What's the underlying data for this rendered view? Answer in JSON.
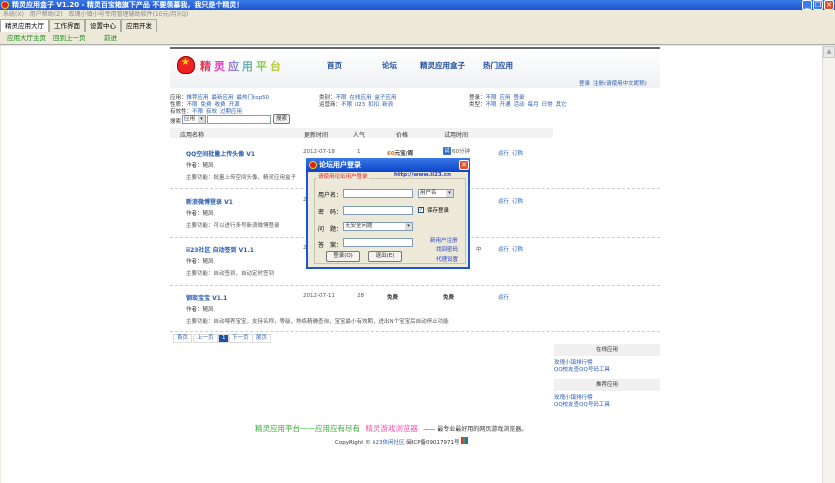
{
  "window": {
    "title": "精灵应用盒子 V1.20 - 精灵百宝箱旗下产品 不要羡慕我，我只是个精灵！",
    "minimize": "_",
    "restore": "❐",
    "close": "✕"
  },
  "menu": [
    "系统(X)",
    "用户帮助(Z)",
    "玫瑰小镇小号专用管理辅助软件(10元/月)(Q)"
  ],
  "tabs": [
    "精灵应用大厅",
    "工作界面",
    "设置中心",
    "应用开发"
  ],
  "toolbar": [
    "应用大厅主页",
    "回到上一页",
    "前进"
  ],
  "header": {
    "logo_text": "精灵应用平台",
    "nav": [
      "首页",
      "论坛",
      "精灵应用盒子",
      "热门应用"
    ],
    "login": "登录",
    "register": "注册(请使用中文昵称)"
  },
  "filters": {
    "app": {
      "label": "应用：",
      "items": [
        "推荐应用",
        "最新应用",
        "最热门top50"
      ]
    },
    "nature": {
      "label": "性质：",
      "items": [
        "不限",
        "免费",
        "收费",
        "开源"
      ]
    },
    "validity": {
      "label": "有效性：",
      "items": [
        "不限",
        "有效",
        "过期应用"
      ]
    },
    "category": {
      "label": "类别：",
      "items": [
        "不限",
        "在线应用",
        "盒子应用"
      ]
    },
    "operator": {
      "label": "运营商：",
      "items": [
        "不限",
        "ii23",
        "扣扣",
        "新浪"
      ]
    },
    "login": {
      "label": "登录：",
      "items": [
        "不限",
        "应用",
        "登录"
      ]
    },
    "type": {
      "label": "类型：",
      "items": [
        "不限",
        "开通",
        "活动",
        "每月",
        "日常",
        "其它"
      ]
    }
  },
  "search": {
    "label": "搜索",
    "select": "应用",
    "value": "",
    "button": "搜索"
  },
  "table": {
    "headers": [
      "应用名称",
      "更新时间",
      "人气",
      "价格",
      "试用时间"
    ],
    "author_label": "作者：",
    "func_label": "主要功能：",
    "rows": [
      {
        "name": "QQ空间批量上传头像 V1",
        "date": "2012-07-18",
        "pop": "1",
        "price_num": "60",
        "price_unit": "元宝/周",
        "trial": "60分钟",
        "author": "随风",
        "desc": "批量上传空间头像，精灵应用盒子",
        "actions": [
          "运行",
          "订购"
        ]
      },
      {
        "name": "新浪微博登录 V1",
        "date": "20",
        "pop": "",
        "price_num": "",
        "price_unit": "",
        "trial": "",
        "author": "随风",
        "desc": "可以进行多号新浪微博登录",
        "actions": [
          "运行",
          "订购"
        ]
      },
      {
        "name": "ii23社区 自动签到 V1.1",
        "date": "20",
        "pop": "",
        "price_num": "",
        "price_unit": "",
        "trial": "中",
        "author": "随风",
        "desc": "自动签到，自动定时签到",
        "actions": [
          "运行",
          "订购"
        ]
      },
      {
        "name": "钢琰宝宝 V1.1",
        "date": "2012-07-11",
        "pop": "28",
        "price_num": "",
        "price_unit": "免费",
        "trial": "免费",
        "author": "随风",
        "desc": "自动喂养宝宝，支持名称，等级，熟练精确查询，宝宝最小有效期，进出N个宝宝后自动停止功能",
        "actions": [
          "运行"
        ]
      }
    ]
  },
  "pagination": [
    "首页",
    "上一页",
    "1",
    "下一页",
    "尾页"
  ],
  "sidebar": [
    {
      "title": "在线应用",
      "links": [
        "玫瑰小镇排行榜",
        "QQ校友查QQ号码工具"
      ]
    },
    {
      "title": "推荐应用",
      "links": [
        "玫瑰小镇排行榜",
        "QQ校友查QQ号码工具"
      ]
    }
  ],
  "footer": {
    "part1": "精灵应用平台——应用应有尽有",
    "part2": "精灵游戏浏览器",
    "part3": "—— 最专业最好用的网页游戏浏览器。",
    "copyright": "CopyRight © ",
    "site": "ii23休闲社区",
    "icp": "闽ICP备09017971号"
  },
  "dialog": {
    "title": "论坛用户登录",
    "legend": "请使用论坛用户登录",
    "url": "http://www.ii23.cn",
    "username_label": "用户名：",
    "username": "",
    "username_type": "用户名",
    "password_label": "密　码：",
    "password": "",
    "save_login": "保存登录",
    "question_label": "问　题：",
    "question": "无安全问题",
    "answer_label": "答　案：",
    "answer": "",
    "login": "登录(O)",
    "exit": "退出(E)",
    "links": [
      "新用户注册",
      "找回密码",
      "代理设置"
    ]
  }
}
